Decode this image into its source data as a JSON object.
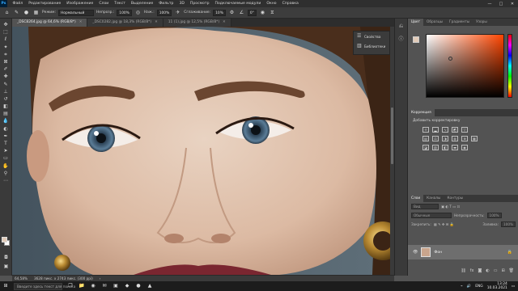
{
  "menubar": {
    "logo": "Ps",
    "items": [
      "Файл",
      "Редактирование",
      "Изображение",
      "Слои",
      "Текст",
      "Выделение",
      "Фильтр",
      "3D",
      "Просмотр",
      "Подключаемые модули",
      "Окно",
      "Справка"
    ],
    "window_buttons": [
      "—",
      "□",
      "✕"
    ]
  },
  "options": {
    "mode_label": "Режим:",
    "mode_value": "Нормальный",
    "opacity_label": "Непрозр.:",
    "opacity_value": "100%",
    "flow_label": "Наж.:",
    "flow_value": "100%",
    "smoothing_label": "Сглаживание:",
    "smoothing_value": "10%",
    "angle_value": "0°"
  },
  "tabs": [
    {
      "label": "_DSC8264.jpg @ 64,6% (RGB/8*)",
      "active": true
    },
    {
      "label": "_DSC0282.jpg @ 18,3% (RGB/8*)",
      "active": false
    },
    {
      "label": "11 (1).jpg @ 12,5% (RGB/8*)",
      "active": false
    }
  ],
  "floating_panel": {
    "properties": "Свойства",
    "libraries": "Библиотеки"
  },
  "status": {
    "zoom": "64,58%",
    "doc_info": "3628 пикс. x 2743 пикс. (300 ppi)"
  },
  "color_panel": {
    "tabs": [
      "Цвет",
      "Образцы",
      "Градиенты",
      "Узоры"
    ],
    "active_tab": "Цвет",
    "foreground": "#e2cbb8",
    "background": "#ffffff"
  },
  "adjustments_panel": {
    "tab": "Коррекция",
    "subtitle": "Добавить корректировку"
  },
  "layers_panel": {
    "tabs": [
      "Слои",
      "Каналы",
      "Контуры"
    ],
    "active_tab": "Слои",
    "kind_filter": "Вид",
    "blend_mode": "Обычные",
    "opacity_label": "Непрозрачность:",
    "opacity_value": "100%",
    "lock_label": "Закрепить:",
    "fill_label": "Заливка:",
    "fill_value": "100%",
    "layer_name": "Фон"
  },
  "taskbar": {
    "search_placeholder": "Введите здесь текст для поиска",
    "language": "ENG",
    "time": "13:24",
    "date": "10.03.2021"
  }
}
